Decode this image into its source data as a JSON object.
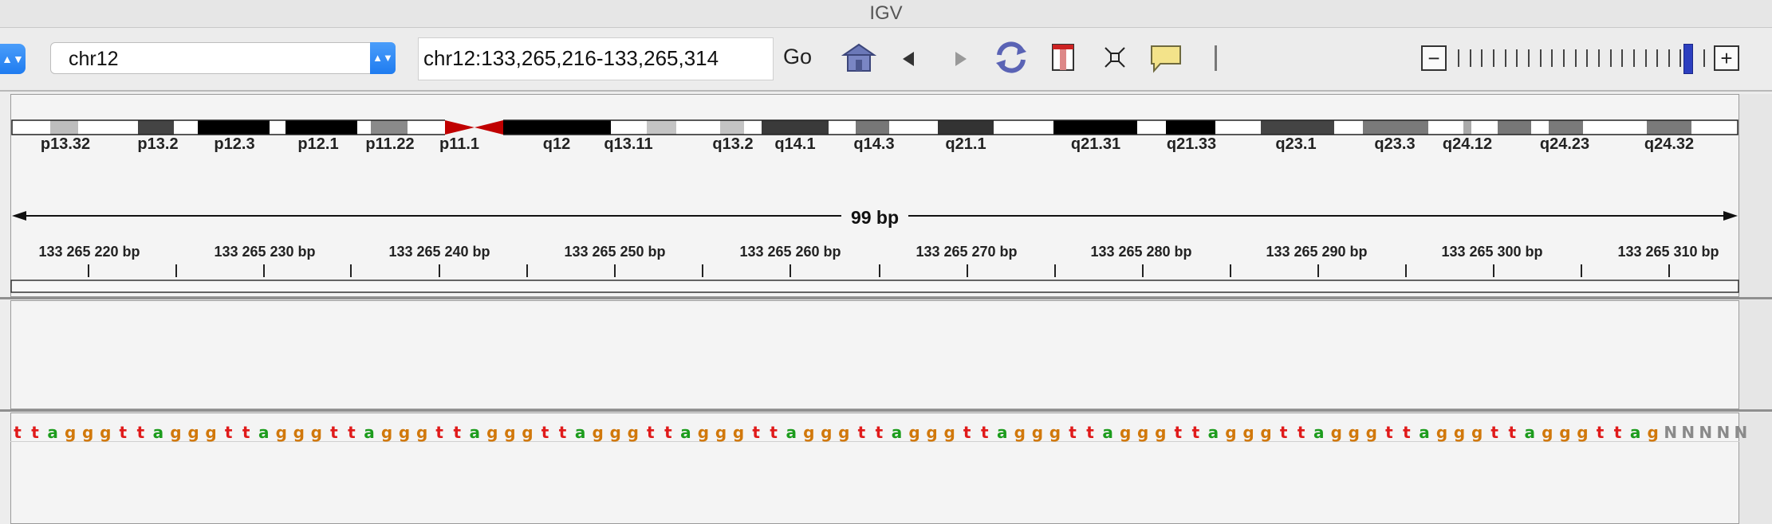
{
  "window": {
    "title": "IGV"
  },
  "toolbar": {
    "genome_stepper_arrows": "▲▼",
    "chromosome": "chr12",
    "chromosome_stepper_arrows": "▲▼",
    "locus": "chr12:133,265,216-133,265,314",
    "go_label": "Go",
    "icons": [
      "home-icon",
      "back-icon",
      "forward-icon",
      "refresh-icon",
      "region-of-interest-icon",
      "fit-to-window-icon",
      "popup-info-icon",
      "separator-icon"
    ],
    "zoom": {
      "minus": "−",
      "plus": "+",
      "tick_count": 22,
      "level_fraction": 0.93
    }
  },
  "ideogram": {
    "bands": [
      "p13.32",
      "p13.2",
      "p12.3",
      "p12.1",
      "p11.22",
      "p11.1",
      "q12",
      "q13.11",
      "q13.2",
      "q14.1",
      "q14.3",
      "q21.1",
      "q21.31",
      "q21.33",
      "q23.1",
      "q23.3",
      "q24.12",
      "q24.23",
      "q24.32"
    ],
    "centromere_color": "#c00000"
  },
  "ruler": {
    "span_label": "99 bp",
    "labels": [
      "133 265 220 bp",
      "133 265 230 bp",
      "133 265 240 bp",
      "133 265 250 bp",
      "133 265 260 bp",
      "133 265 270 bp",
      "133 265 280 bp",
      "133 265 290 bp",
      "133 265 300 bp",
      "133 265 310 bp"
    ]
  },
  "sequence": {
    "bases": "ttagggttagggttagggttagggttagggttagggttagggttagggttagggttagggttagggttagggttagggttagggttagggttagNNNNN",
    "colors": {
      "a": "#1c9c1c",
      "g": "#d1780b",
      "t": "#e01a1a",
      "c": "#1a28e0",
      "N": "#8a8a8a"
    }
  }
}
